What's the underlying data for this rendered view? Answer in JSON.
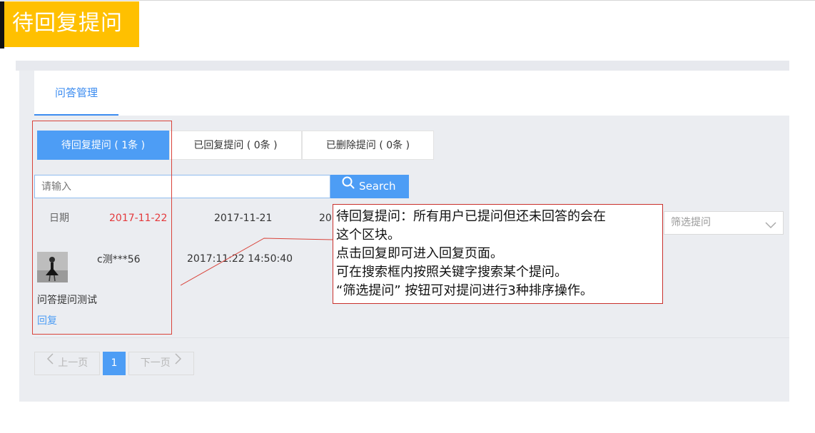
{
  "header": {
    "title": "待回复提问",
    "accent_color": "#ffc000"
  },
  "tabs": [
    {
      "label": "问答管理"
    }
  ],
  "filter_tabs": [
    {
      "label": "待回复提问 ( 1条 )",
      "active": true
    },
    {
      "label": "已回复提问 ( 0条 )",
      "active": false
    },
    {
      "label": "已删除提问 ( 0条 )",
      "active": false
    }
  ],
  "search": {
    "placeholder": "请输入",
    "button_label": "Search",
    "icon": "search-icon"
  },
  "dates": {
    "label": "日期",
    "items": [
      "2017-11-22",
      "2017-11-21",
      "20"
    ]
  },
  "sort_select": {
    "placeholder": "筛选提问",
    "icon": "chevron-down-icon"
  },
  "question_item": {
    "username": "c测***56",
    "time": "2017:11:22 14:50:40",
    "text": "问答提问测试",
    "reply_label": "回复"
  },
  "pagination": {
    "prev_label": "上一页",
    "current_page": "1",
    "next_label": "下一页"
  },
  "callout": {
    "lines": [
      "待回复提问：所有用户已提问但还未回答的会在",
      "这个区块。",
      "点击回复即可进入回复页面。",
      "可在搜索框内按照关键字搜索某个提问。",
      " “筛选提问” 按钮可对提问进行3种排序操作。"
    ]
  },
  "colors": {
    "primary": "#4d9df5",
    "highlight_date": "#e4393c",
    "annotation": "#d9433a"
  }
}
